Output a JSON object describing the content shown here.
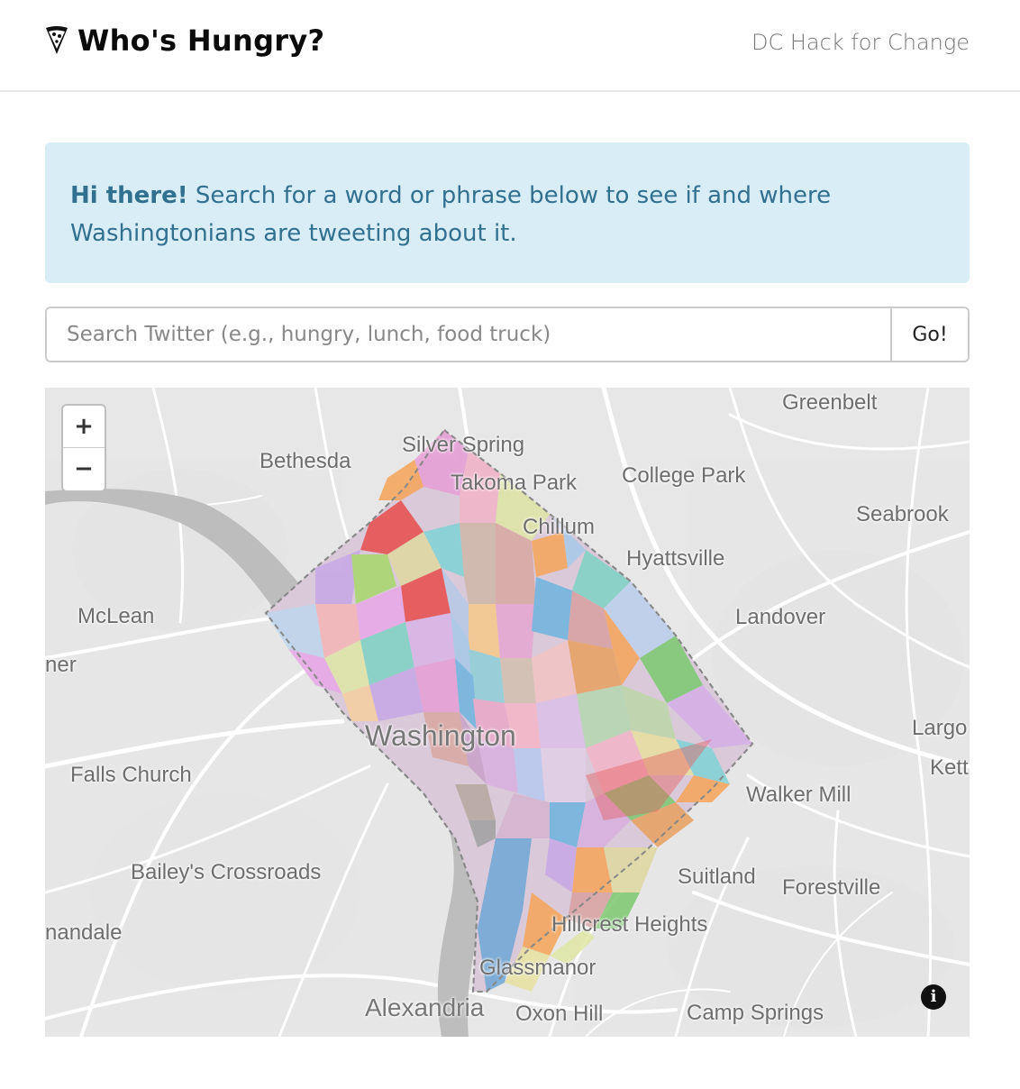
{
  "navbar": {
    "brand_title": "Who's Hungry?",
    "brand_icon": "pizza-slice-icon",
    "link_label": "DC Hack for Change"
  },
  "alert": {
    "greeting": "Hi there!",
    "message": "Search for a word or phrase below to see if and where Washingtonians are tweeting about it."
  },
  "search": {
    "placeholder": "Search Twitter (e.g., hungry, lunch, food truck)",
    "value": "",
    "button_label": "Go!"
  },
  "map": {
    "zoom_in_label": "+",
    "zoom_out_label": "−",
    "info_label": "i",
    "labels": {
      "greenbelt": "Greenbelt",
      "bethesda": "Bethesda",
      "silver_spring": "Silver Spring",
      "takoma_park": "Takoma Park",
      "college_park": "College Park",
      "seabrook": "Seabrook",
      "chillum": "Chillum",
      "hyattsville": "Hyattsville",
      "mclean": "McLean",
      "landover": "Landover",
      "vienna_partial": "ner",
      "largo": "Largo",
      "washington": "Washington",
      "falls_church": "Falls Church",
      "kettering_partial": "Kett",
      "walker_mill": "Walker Mill",
      "baileys_crossroads": "Bailey's Crossroads",
      "suitland": "Suitland",
      "forestville": "Forestville",
      "annandale_partial": "nandale",
      "hillcrest_heights": "Hillcrest Heights",
      "glassmanor": "Glassmanor",
      "alexandria": "Alexandria",
      "oxon_hill": "Oxon Hill",
      "camp_springs": "Camp Springs"
    }
  },
  "colors": {
    "alert_bg": "#d9edf7",
    "alert_text": "#31708f",
    "map_bg": "#e8e8e8",
    "river": "#bdbdbd",
    "roads": "#ffffff"
  }
}
